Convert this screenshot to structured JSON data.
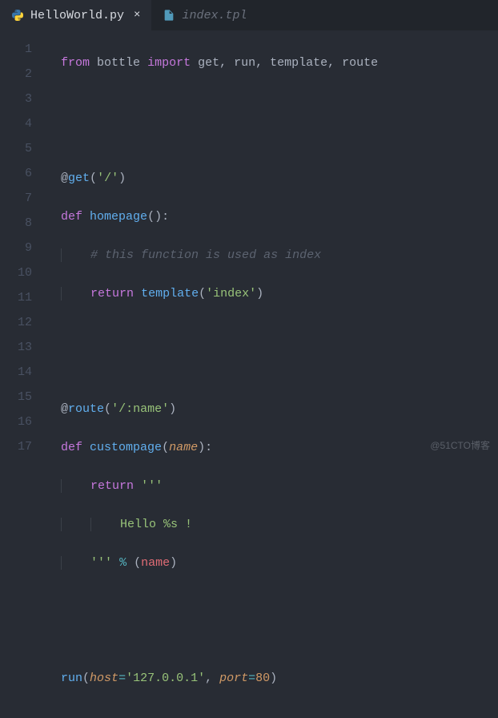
{
  "tabs": [
    {
      "label": "HelloWorld.py",
      "icon": "python-icon",
      "active": true
    },
    {
      "label": "index.tpl",
      "icon": "file-icon",
      "active": false
    }
  ],
  "close_glyph": "×",
  "line_numbers": [
    "1",
    "2",
    "3",
    "4",
    "5",
    "6",
    "7",
    "8",
    "9",
    "10",
    "11",
    "12",
    "13",
    "14",
    "15",
    "16",
    "17"
  ],
  "code": {
    "l1": {
      "kw_from": "from",
      "mod": "bottle",
      "kw_import": "import",
      "names": "get, run, template, route"
    },
    "l4": {
      "at": "@",
      "dec": "get",
      "arg": "'/'"
    },
    "l5": {
      "kw_def": "def",
      "fn": "homepage",
      "params": "()",
      "colon": ":"
    },
    "l6": {
      "comment": "# this function is used as index"
    },
    "l7": {
      "kw_return": "return",
      "fn": "template",
      "arg": "'index'"
    },
    "l10": {
      "at": "@",
      "dec": "route",
      "arg": "'/:name'"
    },
    "l11": {
      "kw_def": "def",
      "fn": "custompage",
      "lp": "(",
      "param": "name",
      "rp": ")",
      "colon": ":"
    },
    "l12": {
      "kw_return": "return",
      "str": "'''"
    },
    "l13": {
      "str": "Hello %s !"
    },
    "l14": {
      "str": "'''",
      "op": "%",
      "lp": "(",
      "name": "name",
      "rp": ")"
    },
    "l17": {
      "fn": "run",
      "lp": "(",
      "p1": "host",
      "eq1": "=",
      "v1": "'127.0.0.1'",
      "comma": ", ",
      "p2": "port",
      "eq2": "=",
      "v2": "80",
      "rp": ")"
    }
  },
  "watermark": "@51CTO博客"
}
